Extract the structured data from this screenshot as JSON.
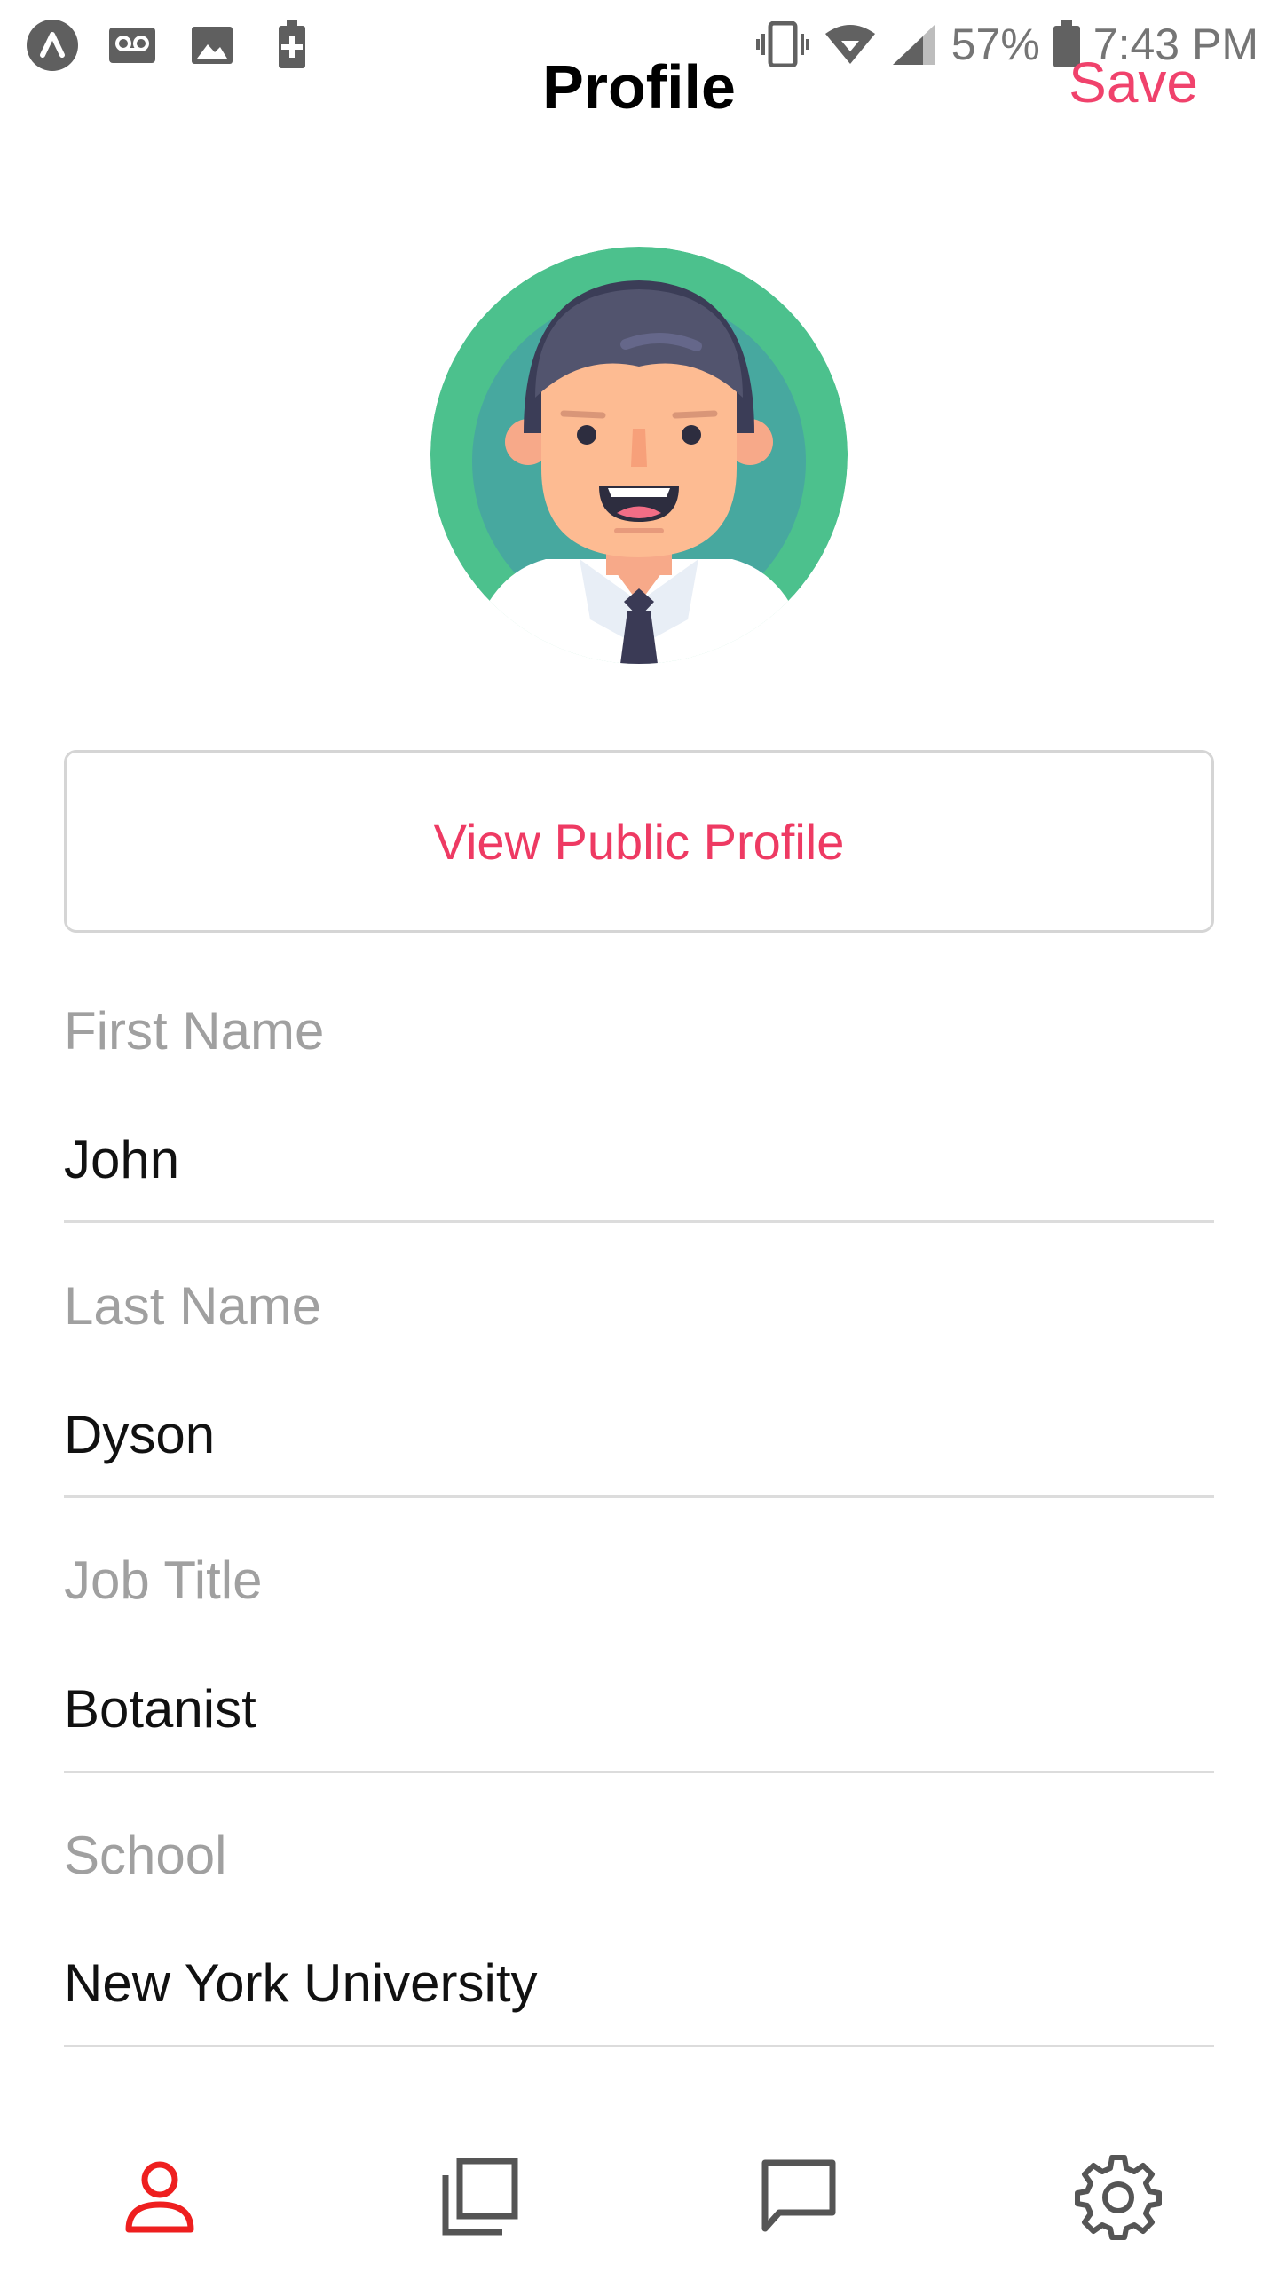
{
  "status_bar": {
    "left_icons": [
      "arrow-app-icon",
      "voicemail-icon",
      "image-icon",
      "battery-saver-icon"
    ],
    "right_icons": [
      "vibrate-icon",
      "wifi-icon",
      "signal-icon",
      "battery-icon"
    ],
    "battery_percent": "57%",
    "time": "7:43 PM"
  },
  "header": {
    "title": "Profile",
    "save_label": "Save"
  },
  "profile": {
    "view_public_profile_label": "View Public Profile"
  },
  "fields": [
    {
      "label": "First Name",
      "value": "John"
    },
    {
      "label": "Last Name",
      "value": "Dyson"
    },
    {
      "label": "Job Title",
      "value": "Botanist"
    },
    {
      "label": "School",
      "value": "New York University"
    }
  ],
  "bottom_nav": {
    "items": [
      {
        "icon": "person-icon",
        "active": true
      },
      {
        "icon": "copy-icon",
        "active": false
      },
      {
        "icon": "chat-icon",
        "active": false
      },
      {
        "icon": "settings-gear-icon",
        "active": false
      }
    ]
  },
  "colors": {
    "accent": "#f0426c",
    "active_nav": "#ee1f1f",
    "inactive_nav": "#555555"
  }
}
